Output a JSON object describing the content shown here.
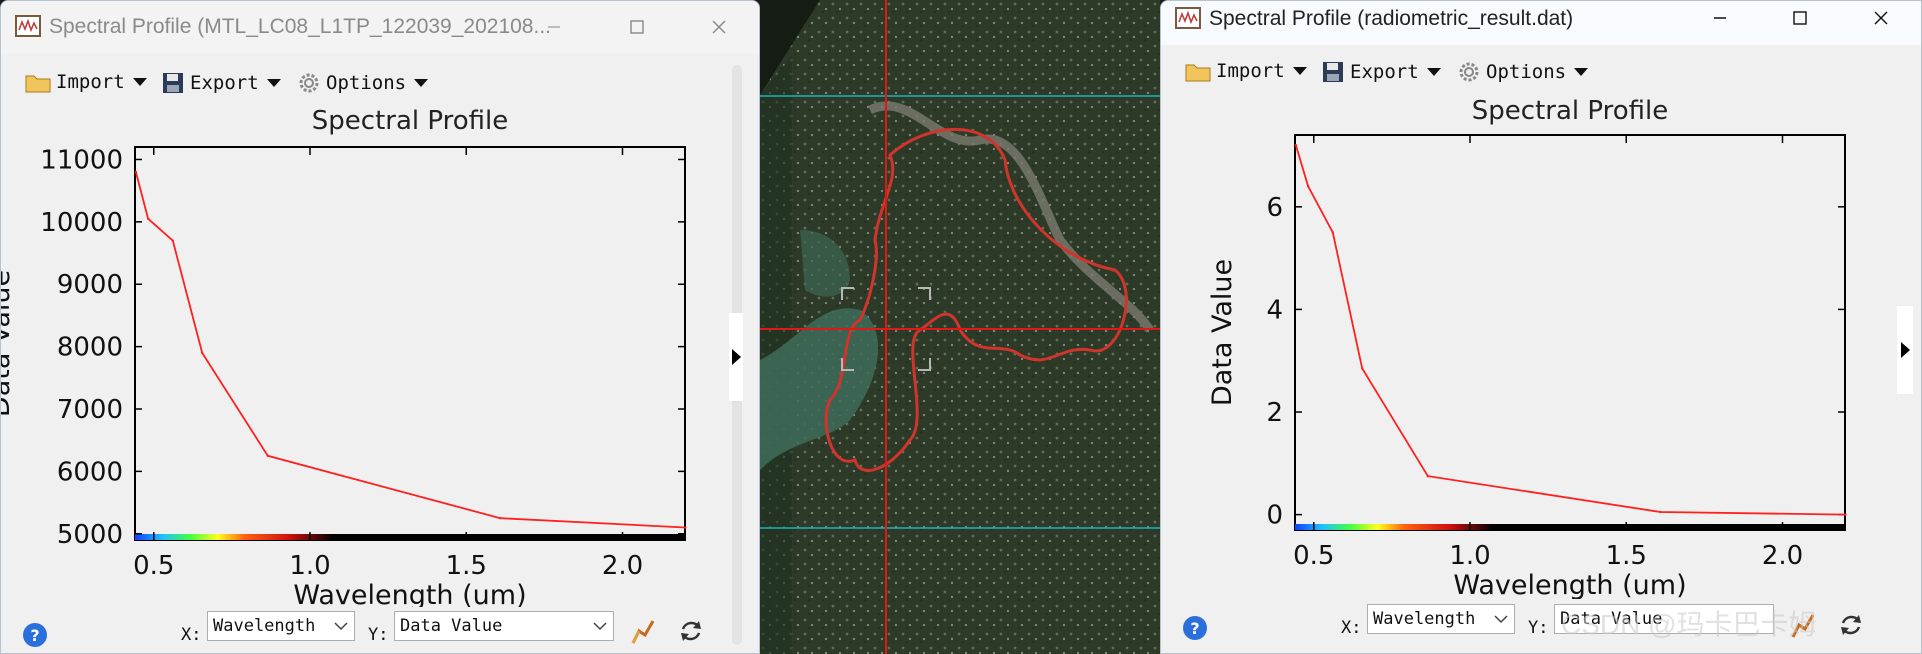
{
  "left_window": {
    "title": "Spectral Profile (MTL_LC08_L1TP_122039_202108...",
    "toolbar": {
      "import_label": "Import",
      "export_label": "Export",
      "options_label": "Options"
    },
    "bottom": {
      "x_label": "X:",
      "x_value": "Wavelength",
      "y_label": "Y:",
      "y_value": "Data Value"
    }
  },
  "right_window": {
    "title": "Spectral Profile (radiometric_result.dat)",
    "toolbar": {
      "import_label": "Import",
      "export_label": "Export",
      "options_label": "Options"
    },
    "bottom": {
      "x_label": "X:",
      "x_value": "Wavelength",
      "y_label": "Y:",
      "y_value": "Data Value"
    }
  },
  "watermark": "CSDN @玛卡巴卡姆",
  "chart_data": [
    {
      "type": "line",
      "title": "Spectral Profile",
      "xlabel": "Wavelength (um)",
      "ylabel": "Data Value",
      "xlim": [
        0.44,
        2.2
      ],
      "ylim": [
        4900,
        11200
      ],
      "xticks": [
        0.5,
        1.0,
        1.5,
        2.0
      ],
      "xtick_labels": [
        "0.5",
        "1.0",
        "1.5",
        "2.0"
      ],
      "yticks": [
        5000,
        6000,
        7000,
        8000,
        9000,
        10000,
        11000
      ],
      "ytick_labels": [
        "5000",
        "6000",
        "7000",
        "8000",
        "9000",
        "10000",
        "11000"
      ],
      "series": [
        {
          "x": [
            0.443,
            0.482,
            0.561,
            0.655,
            0.865,
            1.609,
            2.201
          ],
          "y": [
            10800,
            10050,
            9700,
            7900,
            6250,
            5250,
            5100
          ],
          "color": "#ff2020"
        }
      ]
    },
    {
      "type": "line",
      "title": "Spectral Profile",
      "xlabel": "Wavelength (um)",
      "ylabel": "Data Value",
      "xlim": [
        0.44,
        2.2
      ],
      "ylim": [
        -0.3,
        7.4
      ],
      "xticks": [
        0.5,
        1.0,
        1.5,
        2.0
      ],
      "xtick_labels": [
        "0.5",
        "1.0",
        "1.5",
        "2.0"
      ],
      "yticks": [
        0,
        2,
        4,
        6
      ],
      "ytick_labels": [
        "0",
        "2",
        "4",
        "6"
      ],
      "series": [
        {
          "x": [
            0.443,
            0.482,
            0.561,
            0.655,
            0.865,
            1.609,
            2.201
          ],
          "y": [
            7.2,
            6.4,
            5.5,
            2.85,
            0.75,
            0.05,
            0.0
          ],
          "color": "#ff2020"
        }
      ]
    }
  ]
}
